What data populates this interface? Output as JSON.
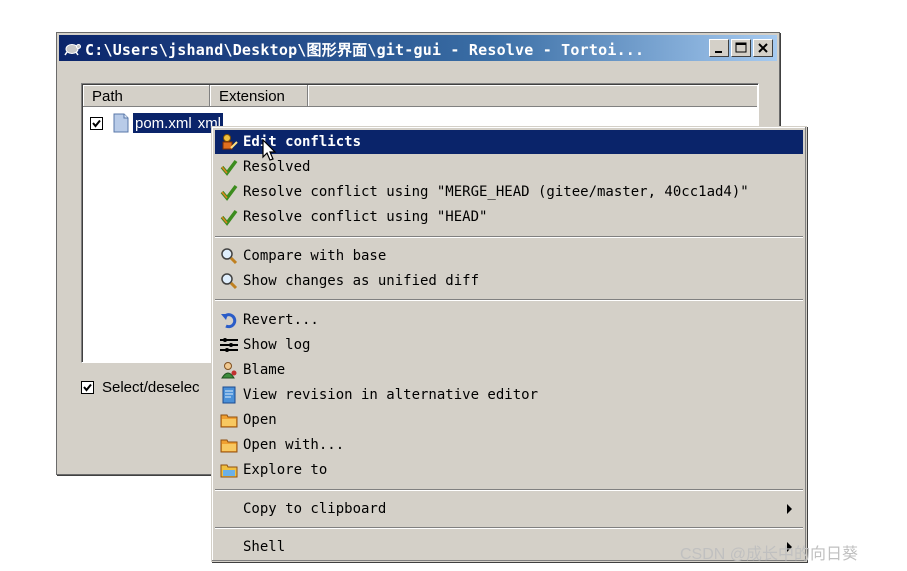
{
  "window": {
    "title": "C:\\Users\\jshand\\Desktop\\图形界面\\git-gui - Resolve - Tortoi..."
  },
  "list": {
    "columns": [
      "Path",
      "Extension"
    ],
    "rows": [
      {
        "path": "pom.xml",
        "extension": "xml",
        "checked": true
      }
    ]
  },
  "select_all_label": "Select/deselec",
  "context_menu": {
    "items": [
      {
        "label": "Edit conflicts",
        "icon": "edit-conflicts-icon",
        "highlighted": true
      },
      {
        "label": "Resolved",
        "icon": "check-icon"
      },
      {
        "label": "Resolve conflict using \"MERGE_HEAD (gitee/master, 40cc1ad4)\"",
        "icon": "check-icon"
      },
      {
        "label": "Resolve conflict using \"HEAD\"",
        "icon": "check-icon"
      },
      {
        "label": "Compare with base",
        "icon": "magnifier-icon"
      },
      {
        "label": "Show changes as unified diff",
        "icon": "magnifier-icon"
      },
      {
        "label": "Revert...",
        "icon": "revert-icon"
      },
      {
        "label": "Show log",
        "icon": "log-icon"
      },
      {
        "label": "Blame",
        "icon": "blame-icon"
      },
      {
        "label": "View revision in alternative editor",
        "icon": "document-icon"
      },
      {
        "label": "Open",
        "icon": "folder-icon"
      },
      {
        "label": "Open with...",
        "icon": "folder-icon"
      },
      {
        "label": "Explore to",
        "icon": "explore-folder-icon"
      },
      {
        "label": "Copy to clipboard",
        "icon": "",
        "submenu": true
      },
      {
        "label": "Shell",
        "icon": "",
        "submenu": true
      }
    ]
  },
  "watermark": "CSDN @成长中的向日葵",
  "colors": {
    "selection": "#0a246a",
    "window_bg": "#d4d0c8",
    "check_green": "#3c8c1e"
  }
}
